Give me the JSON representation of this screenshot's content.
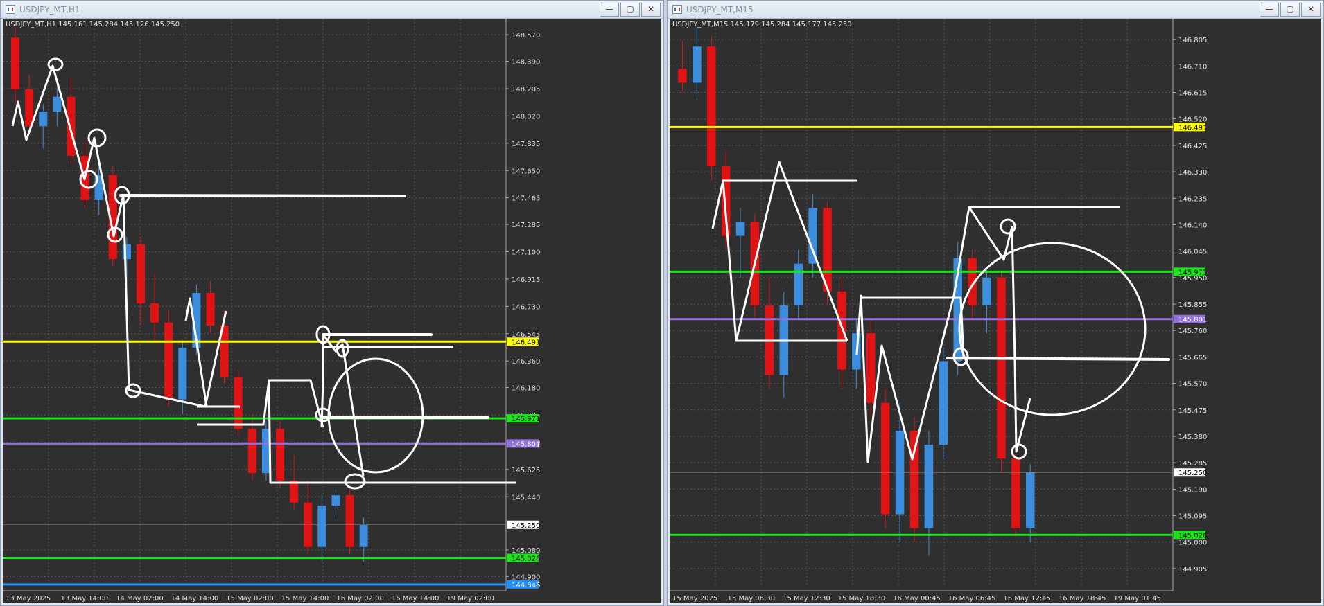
{
  "windows": [
    {
      "title": "USDJPY_MT,H1",
      "symbol_info": "USDJPY_MT,H1  145.161 145.284 145.126 145.250",
      "y_axis": {
        "max": 148.66,
        "min": 144.85
      },
      "y_ticks": [
        "148.570",
        "148.390",
        "148.205",
        "148.020",
        "147.835",
        "147.650",
        "147.465",
        "147.285",
        "147.100",
        "146.915",
        "146.730",
        "146.545",
        "146.360",
        "146.180",
        "145.995",
        "145.810",
        "145.625",
        "145.440",
        "145.080",
        "144.900"
      ],
      "x_ticks": [
        "13 May 2025",
        "13 May 14:00",
        "14 May 02:00",
        "14 May 14:00",
        "15 May 02:00",
        "15 May 14:00",
        "16 May 02:00",
        "16 May 14:00",
        "19 May 02:00"
      ],
      "levels": [
        {
          "label": "146.491",
          "price": 146.491,
          "color": "#ffff00",
          "text_color": "#000000"
        },
        {
          "label": "145.971",
          "price": 145.971,
          "color": "#19e619",
          "text_color": "#000000"
        },
        {
          "label": "145.801",
          "price": 145.801,
          "color": "#9370db",
          "text_color": "#ffffff"
        },
        {
          "label": "145.026",
          "price": 145.026,
          "color": "#19e619",
          "text_color": "#000000"
        },
        {
          "label": "144.846",
          "price": 144.846,
          "color": "#1e90ff",
          "text_color": "#ffffff"
        }
      ],
      "current_price": "145.250",
      "current_price_value": 145.25
    },
    {
      "title": "USDJPY_MT,M15",
      "symbol_info": "USDJPY_MT,M15  145.179 145.284 145.177 145.250",
      "y_axis": {
        "max": 146.87,
        "min": 144.85
      },
      "y_ticks": [
        "146.805",
        "146.710",
        "146.615",
        "146.520",
        "146.425",
        "146.330",
        "146.235",
        "146.140",
        "146.045",
        "145.950",
        "145.855",
        "145.760",
        "145.665",
        "145.570",
        "145.475",
        "145.380",
        "145.285",
        "145.190",
        "145.095",
        "145.000",
        "144.905"
      ],
      "x_ticks": [
        "15 May 2025",
        "15 May 06:30",
        "15 May 12:30",
        "15 May 18:30",
        "16 May 00:45",
        "16 May 06:45",
        "16 May 12:45",
        "16 May 18:45",
        "19 May 01:45"
      ],
      "levels": [
        {
          "label": "146.491",
          "price": 146.491,
          "color": "#ffff00",
          "text_color": "#000000"
        },
        {
          "label": "145.971",
          "price": 145.971,
          "color": "#19e619",
          "text_color": "#000000"
        },
        {
          "label": "145.801",
          "price": 145.801,
          "color": "#9370db",
          "text_color": "#ffffff"
        },
        {
          "label": "145.026",
          "price": 145.026,
          "color": "#19e619",
          "text_color": "#000000"
        }
      ],
      "current_price": "145.250",
      "current_price_value": 145.25
    }
  ],
  "controls": {
    "minimize": "—",
    "maximize": "▢",
    "close": "✕"
  },
  "chart_data": [
    {
      "type": "candlestick",
      "title": "USDJPY_MT,H1",
      "ylim": [
        144.85,
        148.66
      ],
      "candle_colors": {
        "up": "#3c8ddc",
        "down": "#e01414"
      },
      "candles": [
        [
          148.55,
          148.62,
          148.1,
          148.2
        ],
        [
          148.2,
          148.3,
          147.9,
          147.95
        ],
        [
          147.95,
          148.1,
          147.8,
          148.05
        ],
        [
          148.05,
          148.25,
          147.95,
          148.15
        ],
        [
          148.15,
          148.28,
          147.7,
          147.75
        ],
        [
          147.75,
          147.85,
          147.4,
          147.45
        ],
        [
          147.45,
          147.7,
          147.35,
          147.62
        ],
        [
          147.62,
          147.68,
          147.0,
          147.05
        ],
        [
          147.05,
          147.2,
          146.88,
          147.15
        ],
        [
          147.15,
          147.2,
          146.6,
          146.75
        ],
        [
          146.75,
          146.95,
          146.5,
          146.62
        ],
        [
          146.62,
          146.7,
          146.05,
          146.1
        ],
        [
          146.1,
          146.5,
          146.0,
          146.45
        ],
        [
          146.45,
          146.88,
          146.4,
          146.82
        ],
        [
          146.82,
          146.9,
          146.55,
          146.6
        ],
        [
          146.6,
          146.7,
          146.2,
          146.25
        ],
        [
          146.25,
          146.3,
          145.85,
          145.9
        ],
        [
          145.9,
          146.0,
          145.55,
          145.6
        ],
        [
          145.6,
          145.95,
          145.55,
          145.9
        ],
        [
          145.9,
          145.95,
          145.5,
          145.55
        ],
        [
          145.55,
          145.72,
          145.35,
          145.4
        ],
        [
          145.4,
          145.55,
          145.05,
          145.1
        ],
        [
          145.1,
          145.45,
          145.0,
          145.38
        ],
        [
          145.38,
          145.5,
          145.3,
          145.45
        ],
        [
          145.45,
          145.5,
          145.05,
          145.1
        ],
        [
          145.1,
          145.3,
          145.0,
          145.25
        ]
      ]
    },
    {
      "type": "candlestick",
      "title": "USDJPY_MT,M15",
      "ylim": [
        144.85,
        146.87
      ],
      "candle_colors": {
        "up": "#3c8ddc",
        "down": "#e01414"
      },
      "candles": [
        [
          146.7,
          146.8,
          146.62,
          146.65
        ],
        [
          146.65,
          146.85,
          146.6,
          146.78
        ],
        [
          146.78,
          146.82,
          146.3,
          146.35
        ],
        [
          146.35,
          146.4,
          146.05,
          146.1
        ],
        [
          146.1,
          146.2,
          145.95,
          146.15
        ],
        [
          146.15,
          146.18,
          145.8,
          145.85
        ],
        [
          145.85,
          145.95,
          145.55,
          145.6
        ],
        [
          145.6,
          145.9,
          145.52,
          145.85
        ],
        [
          145.85,
          146.05,
          145.8,
          146.0
        ],
        [
          146.0,
          146.25,
          145.95,
          146.2
        ],
        [
          146.2,
          146.22,
          145.85,
          145.9
        ],
        [
          145.9,
          145.95,
          145.55,
          145.62
        ],
        [
          145.62,
          145.8,
          145.55,
          145.75
        ],
        [
          145.75,
          145.8,
          145.45,
          145.5
        ],
        [
          145.5,
          145.55,
          145.05,
          145.1
        ],
        [
          145.1,
          145.5,
          145.0,
          145.4
        ],
        [
          145.4,
          145.45,
          145.0,
          145.05
        ],
        [
          145.05,
          145.4,
          144.95,
          145.35
        ],
        [
          145.35,
          145.7,
          145.3,
          145.65
        ],
        [
          145.65,
          146.08,
          145.6,
          146.02
        ],
        [
          146.02,
          146.05,
          145.8,
          145.85
        ],
        [
          145.85,
          145.98,
          145.75,
          145.95
        ],
        [
          145.95,
          145.97,
          145.25,
          145.3
        ],
        [
          145.3,
          145.32,
          145.02,
          145.05
        ],
        [
          145.05,
          145.28,
          145.0,
          145.25
        ]
      ]
    }
  ]
}
